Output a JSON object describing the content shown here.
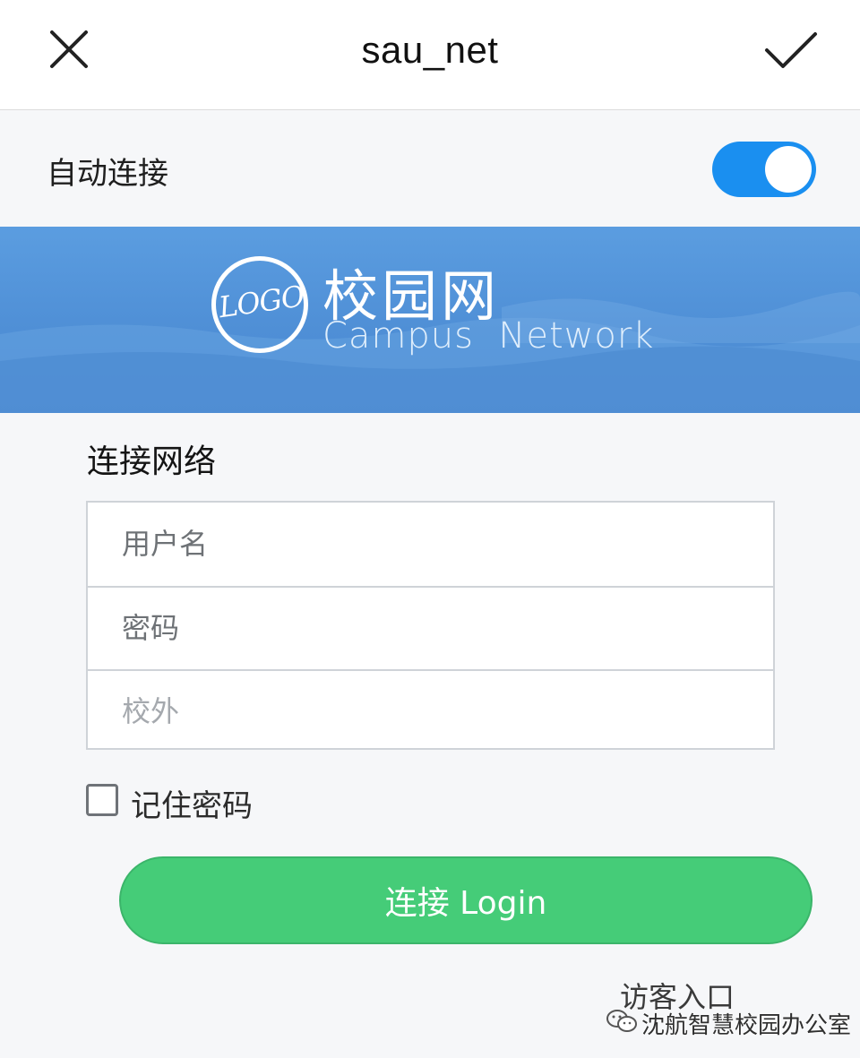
{
  "header": {
    "title": "sau_net",
    "close_icon": "close-icon",
    "confirm_icon": "check-icon"
  },
  "auto_connect": {
    "label": "自动连接",
    "enabled": true,
    "color": "#1a8ff0"
  },
  "banner": {
    "logo_text": "LOGO",
    "title_cn": "校园网",
    "title_en": "Campus  Network",
    "background": "#4f8fd6"
  },
  "form": {
    "section_title": "连接网络",
    "username_placeholder": "用户名",
    "password_placeholder": "密码",
    "location_placeholder": "校外",
    "remember_label": "记住密码",
    "remember_checked": false
  },
  "login_button": {
    "label": "连接 Login",
    "color": "#45cc78"
  },
  "guest_link": "访客入口",
  "watermark": {
    "icon": "wechat-icon",
    "text": "沈航智慧校园办公室"
  }
}
